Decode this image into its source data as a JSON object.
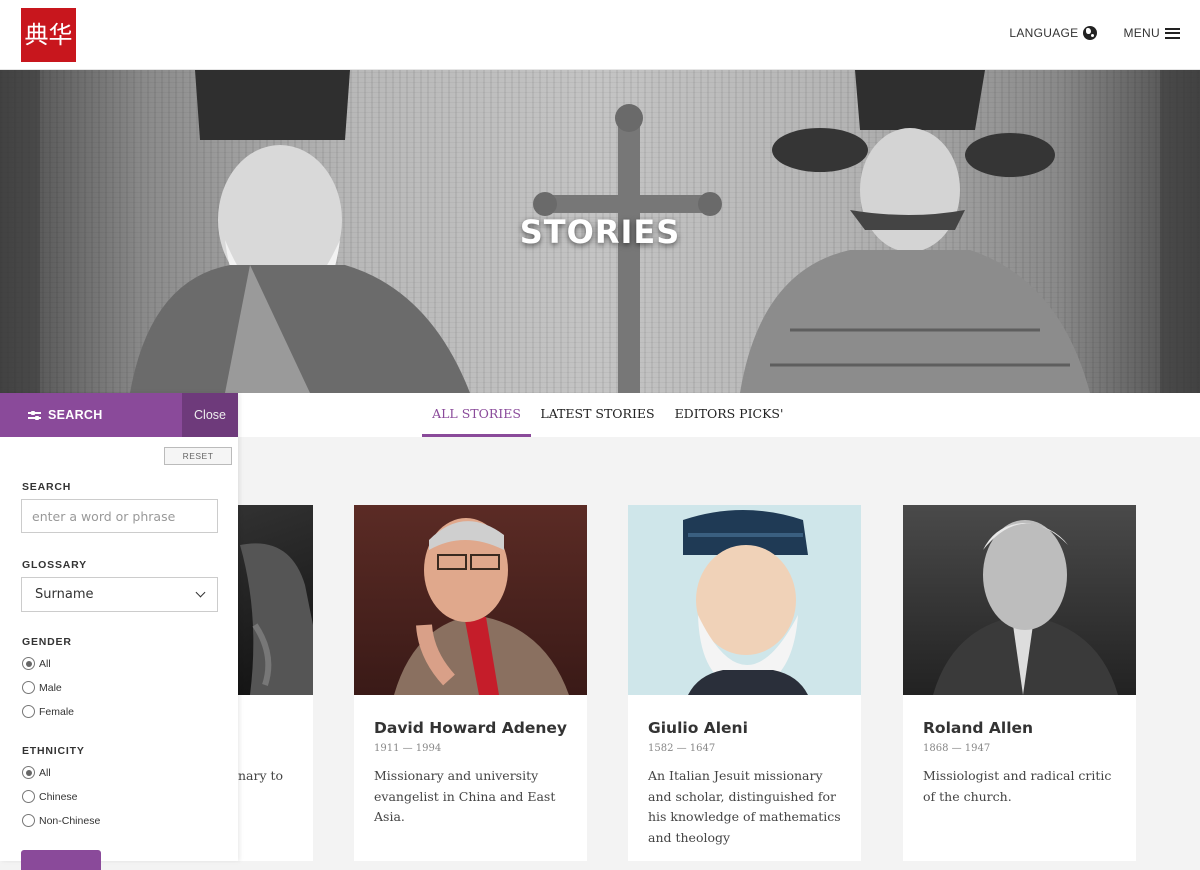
{
  "header": {
    "logo_text": "典华",
    "language_label": "LANGUAGE",
    "menu_label": "MENU",
    "brand_color": "#c8161d"
  },
  "hero": {
    "title": "STORIES"
  },
  "tabs": [
    {
      "label": "ALL STORIES",
      "active": true
    },
    {
      "label": "LATEST STORIES",
      "active": false
    },
    {
      "label": "EDITORS PICKS'",
      "active": false
    }
  ],
  "cards": [
    {
      "name": "",
      "dates": "",
      "description": "nary to"
    },
    {
      "name": "David Howard Adeney",
      "dates": "1911 — 1994",
      "description": "Missionary and university evangelist in China and East Asia."
    },
    {
      "name": "Giulio Aleni",
      "dates": "1582 — 1647",
      "description": "An Italian Jesuit missionary and scholar, distinguished for his knowledge of mathematics and theology"
    },
    {
      "name": "Roland Allen",
      "dates": "1868 — 1947",
      "description": "Missiologist and radical critic of the church."
    }
  ],
  "sidebar": {
    "title": "SEARCH",
    "close_label": "Close",
    "reset_label": "RESET",
    "accent_color": "#8a4a9a",
    "search": {
      "label": "SEARCH",
      "placeholder": "enter a word or phrase",
      "value": ""
    },
    "glossary": {
      "label": "GLOSSARY",
      "selected": "Surname"
    },
    "gender": {
      "label": "GENDER",
      "options": [
        "All",
        "Male",
        "Female"
      ],
      "selected": "All"
    },
    "ethnicity": {
      "label": "ETHNICITY",
      "options": [
        "All",
        "Chinese",
        "Non-Chinese"
      ],
      "selected": "All"
    }
  }
}
